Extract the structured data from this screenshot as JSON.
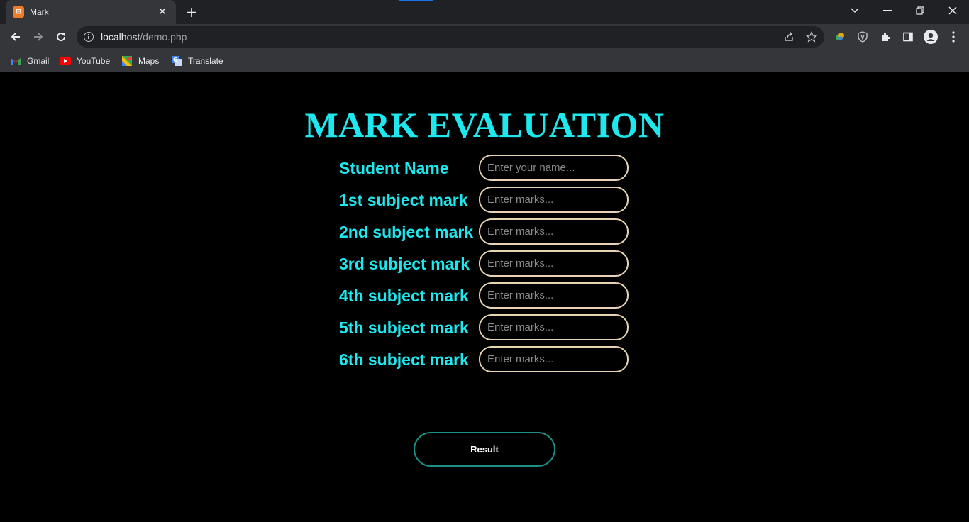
{
  "browser": {
    "tab": {
      "title": "Mark",
      "favicon_glyph": "⊞"
    },
    "url_host": "localhost",
    "url_path": "/demo.php",
    "bookmarks": [
      {
        "label": "Gmail",
        "icon": "gmail-icon"
      },
      {
        "label": "YouTube",
        "icon": "youtube-icon"
      },
      {
        "label": "Maps",
        "icon": "maps-icon"
      },
      {
        "label": "Translate",
        "icon": "translate-icon"
      }
    ]
  },
  "page": {
    "title": "MARK EVALUATION",
    "fields": [
      {
        "label": "Student Name",
        "placeholder": "Enter your name..."
      },
      {
        "label": "1st subject mark",
        "placeholder": "Enter marks..."
      },
      {
        "label": "2nd subject mark",
        "placeholder": "Enter marks..."
      },
      {
        "label": "3rd subject mark",
        "placeholder": "Enter marks..."
      },
      {
        "label": "4th subject mark",
        "placeholder": "Enter marks..."
      },
      {
        "label": "5th subject mark",
        "placeholder": "Enter marks..."
      },
      {
        "label": "6th subject mark",
        "placeholder": "Enter marks..."
      }
    ],
    "result_label": "Result"
  },
  "colors": {
    "accent_cyan": "#1ee8ee",
    "input_border": "#e8d4b4",
    "button_border": "#1c8f86",
    "background": "#000000"
  }
}
